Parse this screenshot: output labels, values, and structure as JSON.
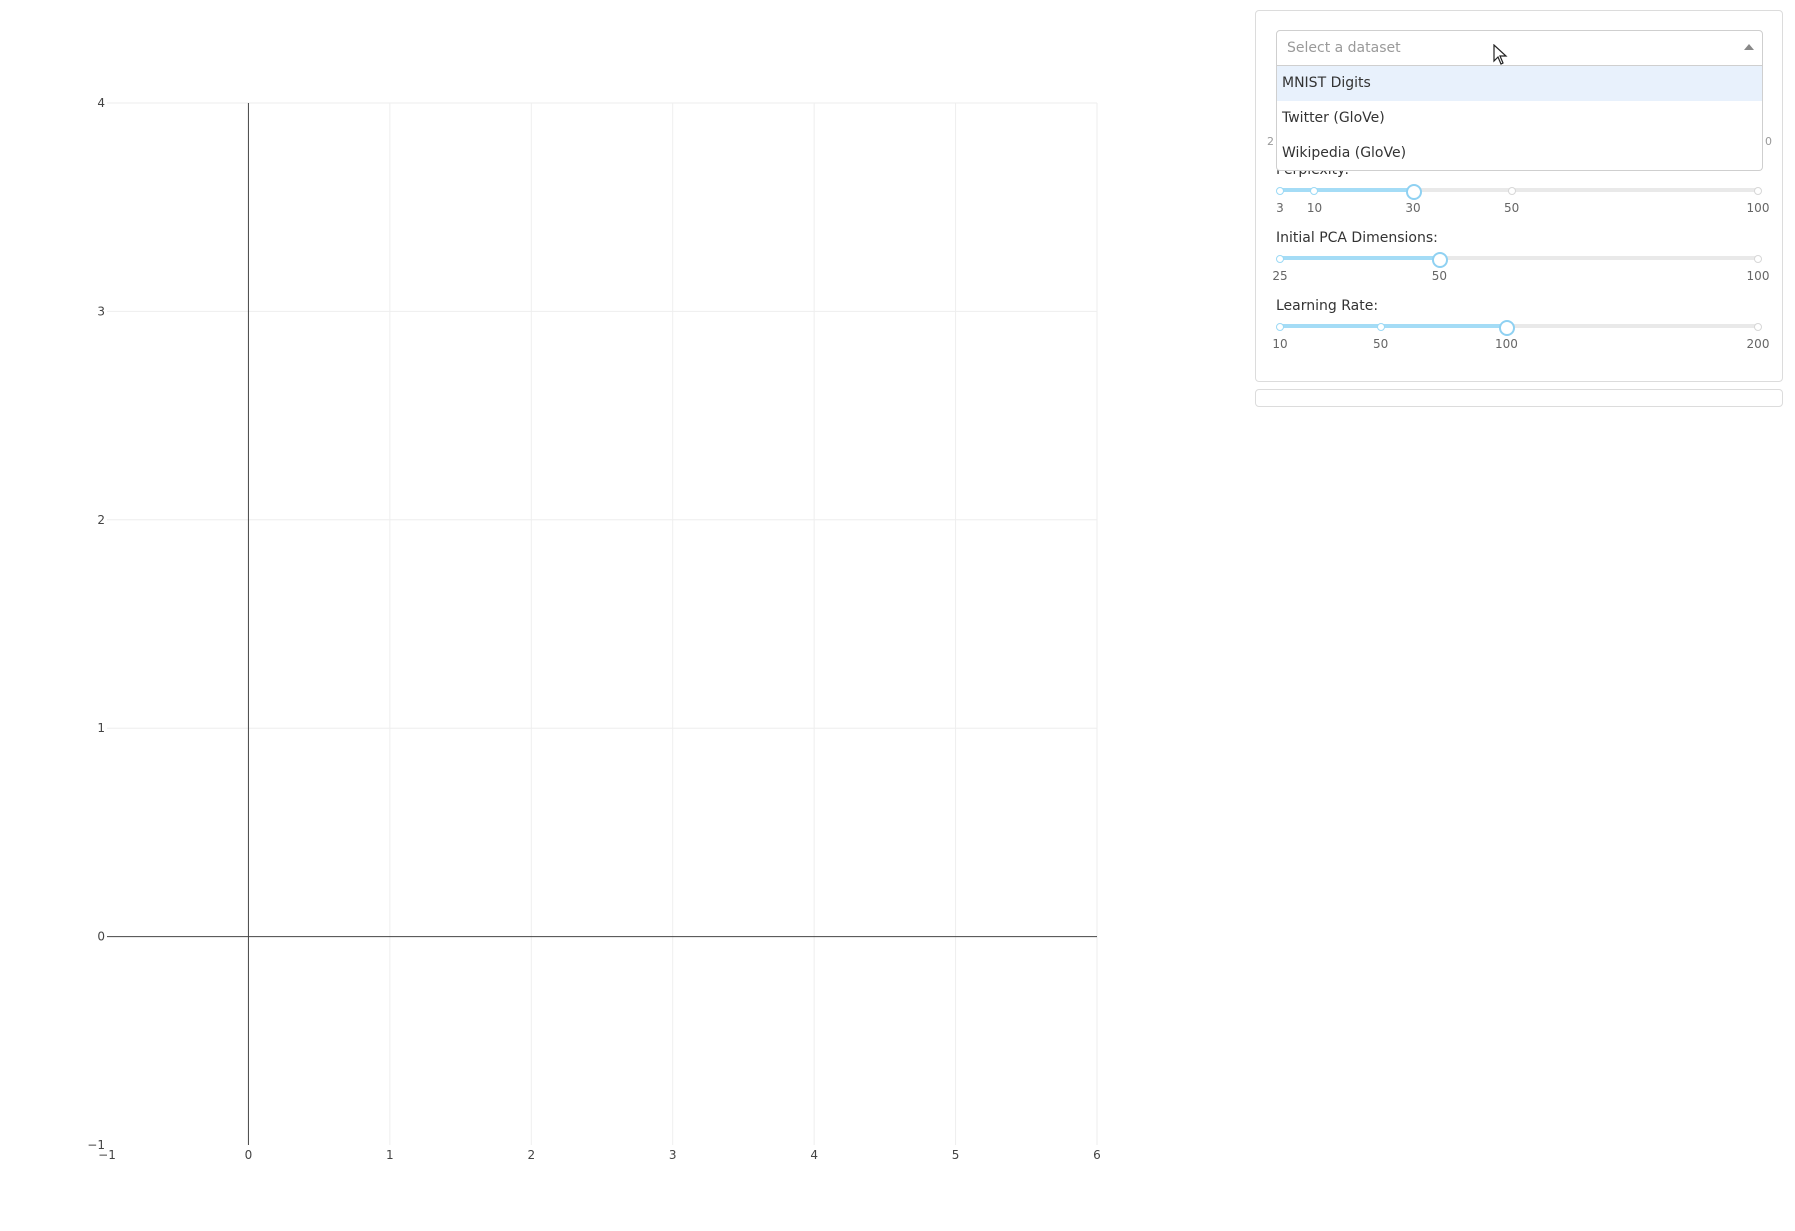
{
  "chart_data": {
    "type": "scatter",
    "title": "",
    "xlabel": "",
    "ylabel": "",
    "x": [],
    "y": [],
    "xlim": [
      -1,
      6
    ],
    "ylim": [
      -1,
      4
    ],
    "x_ticks": [
      "−1",
      "0",
      "1",
      "2",
      "3",
      "4",
      "5",
      "6"
    ],
    "y_ticks": [
      "−1",
      "0",
      "1",
      "2",
      "3",
      "4"
    ],
    "grid": true,
    "zero_lines": true
  },
  "controls": {
    "dataset_select": {
      "placeholder": "Select a dataset",
      "options": [
        "MNIST Digits",
        "Twitter (GloVe)",
        "Wikipedia (GloVe)"
      ],
      "highlighted": "MNIST Digits",
      "open": true
    },
    "hidden_slider_ticks": [
      "2",
      "0"
    ],
    "sliders": [
      {
        "label": "Perplexity:",
        "min": 3,
        "max": 100,
        "value": 30,
        "marks": [
          3,
          10,
          30,
          50,
          100
        ],
        "mark_labels": [
          "3",
          "10",
          "30",
          "50",
          "100"
        ]
      },
      {
        "label": "Initial PCA Dimensions:",
        "min": 25,
        "max": 100,
        "value": 50,
        "marks": [
          25,
          50,
          100
        ],
        "mark_labels": [
          "25",
          "50",
          "100"
        ]
      },
      {
        "label": "Learning Rate:",
        "min": 10,
        "max": 200,
        "value": 100,
        "marks": [
          10,
          50,
          100,
          200
        ],
        "mark_labels": [
          "10",
          "50",
          "100",
          "200"
        ]
      }
    ]
  },
  "colors": {
    "accent": "#8fd1f2",
    "accent_fill": "#a4dcf6",
    "grid": "#eeeeee",
    "axis": "#444444",
    "option_highlight": "#e8f1fc"
  },
  "cursor_icon": "arrow-cursor-icon"
}
